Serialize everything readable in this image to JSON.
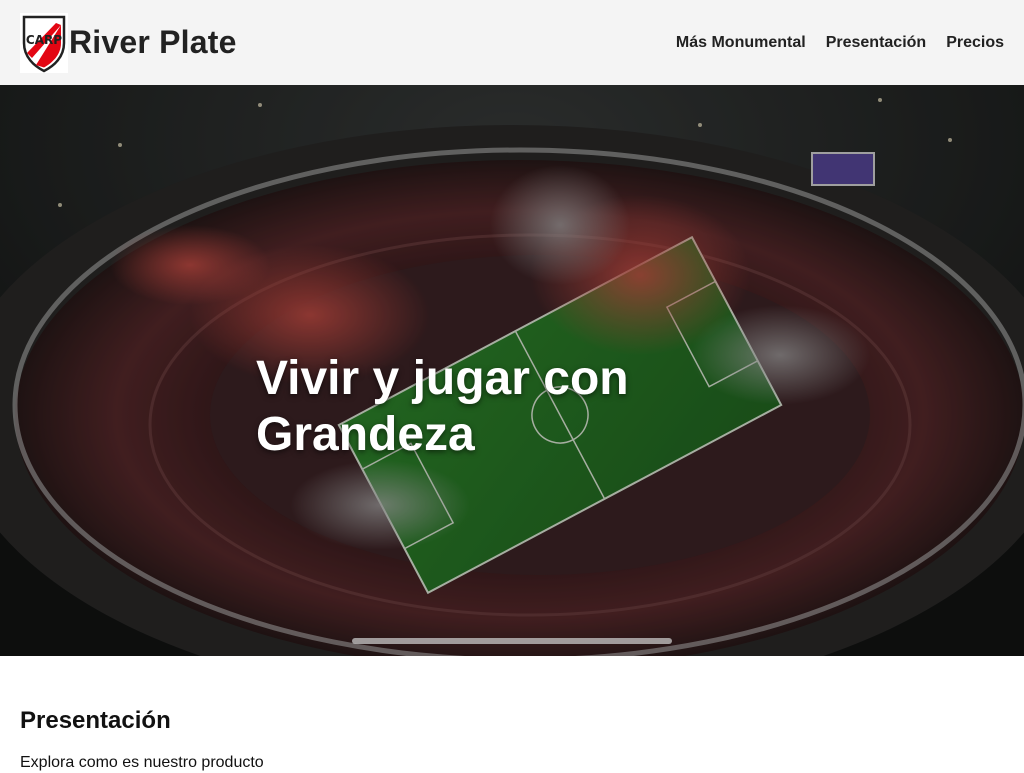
{
  "brand": {
    "name": "River Plate",
    "logo_icon": "river-plate-crest-icon"
  },
  "nav": {
    "items": [
      {
        "label": "Más Monumental"
      },
      {
        "label": "Presentación"
      },
      {
        "label": "Precios"
      }
    ]
  },
  "hero": {
    "title_line1": "Vivir y jugar con",
    "title_line2": "Grandeza",
    "image": "stadium-aerial-night-photo"
  },
  "section": {
    "title": "Presentación",
    "text": "Explora como es nuestro producto"
  },
  "colors": {
    "header_bg": "#f4f4f4",
    "text_dark": "#222222",
    "crest_red": "#e30613",
    "pitch_green": "#2f7a2c"
  }
}
